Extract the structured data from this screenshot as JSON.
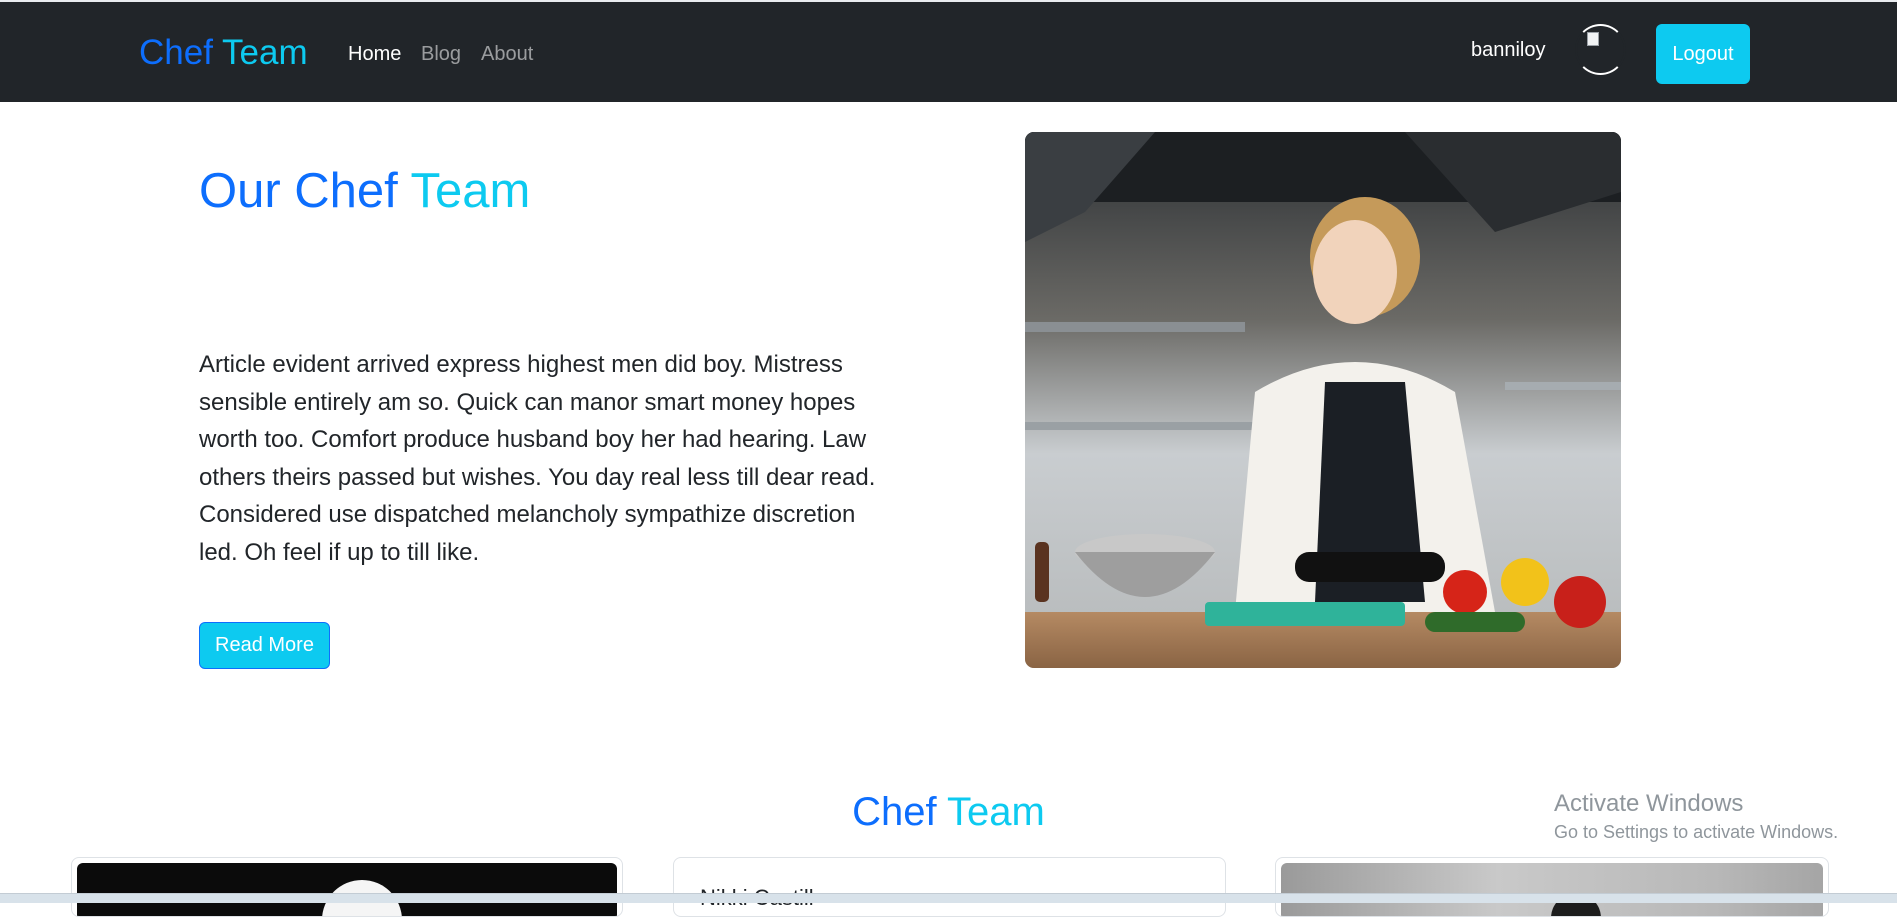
{
  "navbar": {
    "brand_part1": "Chef",
    "brand_part2": "Team",
    "links": [
      {
        "label": "Home",
        "active": true
      },
      {
        "label": "Blog",
        "active": false
      },
      {
        "label": "About",
        "active": false
      }
    ],
    "username": "banniloy",
    "logout_label": "Logout"
  },
  "hero": {
    "title_part1": "Our Chef",
    "title_part2": "Team",
    "text": "Article evident arrived express highest men did boy. Mistress sensible entirely am so. Quick can manor smart money hopes worth too. Comfort produce husband boy her had hearing. Law others theirs passed but wishes. You day real less till dear read. Considered use dispatched melancholy sympathize discretion led. Oh feel if up to till like.",
    "button_label": "Read More"
  },
  "team_section": {
    "title_part1": "Chef",
    "title_part2": "Team",
    "cards": [
      {
        "name": ""
      },
      {
        "name": "Nikki Castill"
      },
      {
        "name": ""
      }
    ]
  },
  "watermark": {
    "title": "Activate Windows",
    "subtitle": "Go to Settings to activate Windows."
  },
  "colors": {
    "primary_blue": "#0d6efd",
    "accent_cyan": "#0dcaf0",
    "navbar_bg": "#212529"
  }
}
